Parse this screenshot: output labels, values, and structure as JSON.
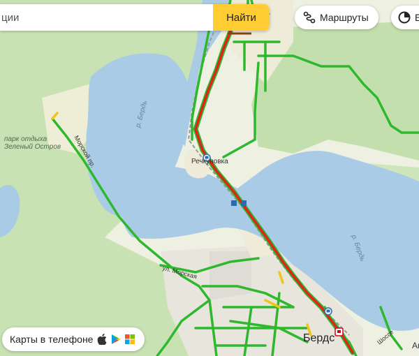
{
  "search": {
    "placeholder": "ции",
    "find_label": "Найти"
  },
  "routes": {
    "label": "Маршруты"
  },
  "extra": {
    "label": "Б"
  },
  "apps": {
    "label": "Карты в телефоне",
    "icons": [
      "apple-icon",
      "google-play-icon",
      "windows-store-icon"
    ]
  },
  "labels": {
    "park": [
      "парк отдыха",
      "Зеленый Остров"
    ],
    "river1": "р. Бердь",
    "river2": "р. Бердь",
    "station": "Речкуновка",
    "city": "Бердск",
    "city_partial": "Бердс",
    "street1": "Морской пр.",
    "street2": "ул. Морская",
    "bottom_right1": "Шоссе",
    "bottom_right2": "Ап"
  },
  "traffic_colors": {
    "free": "#2eb82e",
    "slow": "#f0c419",
    "jam": "#e2231a"
  },
  "map_colors": {
    "water": "#a8c8e4",
    "forest": "#c6e0b0",
    "land": "#f2f0e4",
    "urban": "#e4e2dc"
  }
}
